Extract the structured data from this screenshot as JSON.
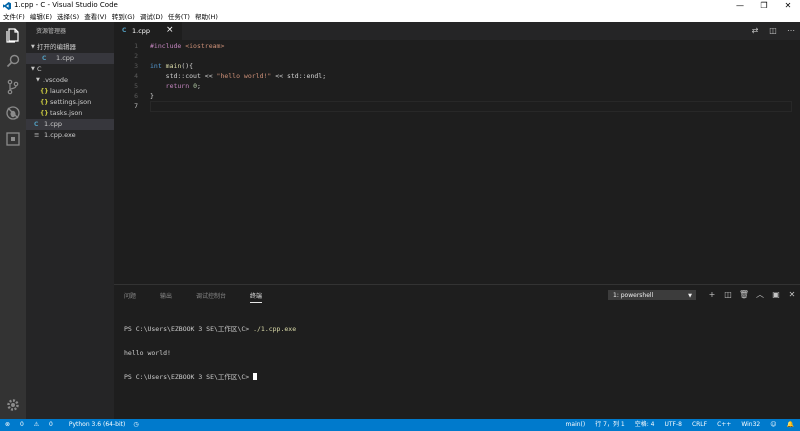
{
  "window": {
    "title": "1.cpp - C - Visual Studio Code"
  },
  "menu": [
    "文件(F)",
    "编辑(E)",
    "选择(S)",
    "查看(V)",
    "转到(G)",
    "调试(D)",
    "任务(T)",
    "帮助(H)"
  ],
  "sidebar": {
    "header": "资源管理器",
    "open_editors_label": "打开的编辑器",
    "open_editor_file": "1.cpp",
    "folder_name": "C",
    "vscode_folder": ".vscode",
    "vscode_files": [
      "launch.json",
      "settings.json",
      "tasks.json"
    ],
    "files": [
      "1.cpp",
      "1.cpp.exe"
    ]
  },
  "tab": {
    "label": "1.cpp",
    "close": "×"
  },
  "editor": {
    "line_numbers": [
      "1",
      "2",
      "3",
      "4",
      "5",
      "6",
      "7"
    ],
    "lines": [
      {
        "parts": [
          {
            "t": "#include ",
            "c": "#c586c0"
          },
          {
            "t": "<iostream>",
            "c": "#ce9178"
          }
        ]
      },
      {
        "parts": []
      },
      {
        "parts": [
          {
            "t": "int ",
            "c": "#569cd6"
          },
          {
            "t": "main",
            "c": "#dcdcaa"
          },
          {
            "t": "(){",
            "c": "#d4d4d4"
          }
        ]
      },
      {
        "parts": [
          {
            "t": "    std::cout << ",
            "c": "#d4d4d4"
          },
          {
            "t": "\"hello world!\"",
            "c": "#ce9178"
          },
          {
            "t": " << std::endl;",
            "c": "#d4d4d4"
          }
        ]
      },
      {
        "parts": [
          {
            "t": "    ",
            "c": "#d4d4d4"
          },
          {
            "t": "return ",
            "c": "#c586c0"
          },
          {
            "t": "0",
            "c": "#b5cea8"
          },
          {
            "t": ";",
            "c": "#d4d4d4"
          }
        ]
      },
      {
        "parts": [
          {
            "t": "}",
            "c": "#d4d4d4"
          }
        ]
      },
      {
        "parts": []
      }
    ]
  },
  "panel": {
    "tabs": [
      "问题",
      "输出",
      "调试控制台",
      "终端"
    ],
    "active_tab": "终端",
    "terminal_select": "1: powershell",
    "terminal": {
      "prompt1": "PS C:\\Users\\EZBOOK 3 SE\\工作区\\C> ",
      "cmd1": "./1.cpp.exe",
      "output": "hello world!",
      "prompt2": "PS C:\\Users\\EZBOOK 3 SE\\工作区\\C> "
    }
  },
  "status": {
    "errors": "0",
    "warnings": "0",
    "python": "Python 3.6 (64-bit)",
    "branch": "main()",
    "position": "行 7，列 1",
    "indent": "空格: 4",
    "encoding": "UTF-8",
    "eol": "CRLF",
    "language": "C++",
    "platform": "Win32"
  },
  "colors": {
    "statusbar": "#007acc",
    "activitybar": "#333333",
    "sidebar": "#252526",
    "editor": "#1e1e1e"
  }
}
